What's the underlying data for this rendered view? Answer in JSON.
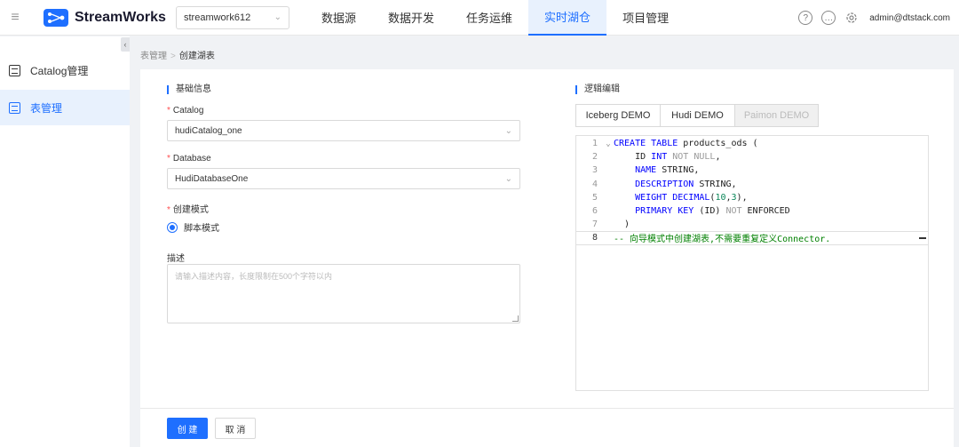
{
  "app": {
    "name": "StreamWorks",
    "project": "streamwork612"
  },
  "nav": [
    {
      "label": "数据源",
      "active": false
    },
    {
      "label": "数据开发",
      "active": false
    },
    {
      "label": "任务运维",
      "active": false
    },
    {
      "label": "实时湖仓",
      "active": true
    },
    {
      "label": "项目管理",
      "active": false
    }
  ],
  "header_icons": [
    "help-icon",
    "message-icon",
    "gear-icon"
  ],
  "user": "admin@dtstack.com",
  "sidebar": {
    "collapse_glyph": "‹",
    "items": [
      {
        "label": "Catalog管理",
        "icon": "catalog-icon",
        "active": false
      },
      {
        "label": "表管理",
        "icon": "table-icon",
        "active": true
      }
    ]
  },
  "breadcrumb": {
    "parent": "表管理",
    "separator": ">",
    "current": "创建湖表"
  },
  "basic": {
    "title": "基础信息",
    "catalog_label": "Catalog",
    "catalog_value": "hudiCatalog_one",
    "database_label": "Database",
    "database_value": "HudiDatabaseOne",
    "mode_label": "创建模式",
    "mode_option": "脚本模式",
    "desc_label": "描述",
    "desc_placeholder": "请输入描述内容，长度限制在500个字符以内"
  },
  "logic": {
    "title": "逻辑编辑",
    "tabs": [
      {
        "label": "Iceberg DEMO",
        "disabled": false
      },
      {
        "label": "Hudi DEMO",
        "disabled": false
      },
      {
        "label": "Paimon DEMO",
        "disabled": true
      }
    ]
  },
  "code_lines": [
    {
      "n": "1",
      "fold": "⌄"
    },
    {
      "n": "2",
      "fold": ""
    },
    {
      "n": "3",
      "fold": ""
    },
    {
      "n": "4",
      "fold": ""
    },
    {
      "n": "5",
      "fold": ""
    },
    {
      "n": "6",
      "fold": ""
    },
    {
      "n": "7",
      "fold": ""
    },
    {
      "n": "8",
      "fold": ""
    }
  ],
  "code": {
    "l1": {
      "kw": "CREATE TABLE",
      "rest": " products_ods ("
    },
    "l2": {
      "name": "ID",
      "type": "INT",
      "gray": "NOT NULL",
      "tail": ","
    },
    "l3": {
      "name": "NAME",
      "type": "STRING",
      "tail": ","
    },
    "l4": {
      "name": "DESCRIPTION",
      "type": "STRING",
      "tail": ","
    },
    "l5": {
      "name": "WEIGHT",
      "type": "DECIMAL",
      "open": "(",
      "n1": "10",
      "comma": ",",
      "n2": "3",
      "close": ")",
      "tail": ","
    },
    "l6": {
      "kw": "PRIMARY KEY",
      "mid": " (ID) ",
      "gray": "NOT",
      "tail": " ENFORCED"
    },
    "l7": {
      "text": ")"
    },
    "l8": {
      "comment": "-- 向导模式中创建湖表,不需要重复定义Connector."
    }
  },
  "buttons": {
    "create": "创 建",
    "cancel": "取 消"
  },
  "colors": {
    "primary": "#1e6fff",
    "keyword": "#0000ff",
    "comment": "#008000",
    "number": "#098658"
  }
}
